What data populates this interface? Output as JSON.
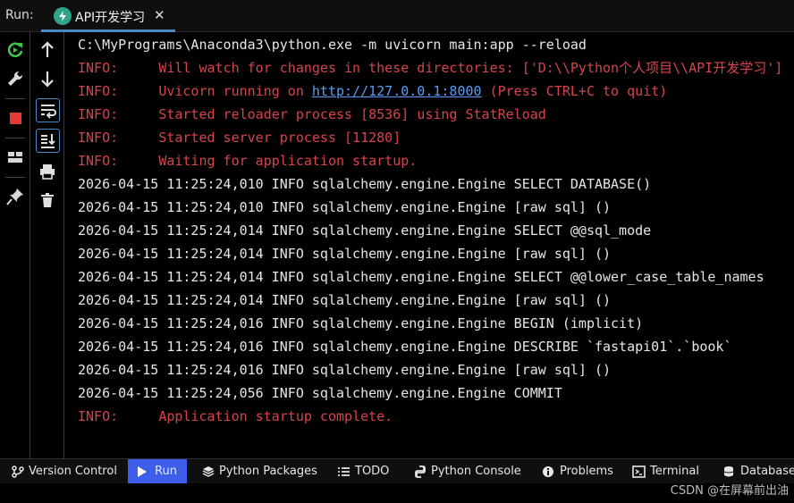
{
  "run_bar": {
    "label": "Run:",
    "tab_title": "API开发学习",
    "close_glyph": "✕"
  },
  "left_toolbar": {
    "icons": [
      "rerun-icon",
      "wrench-icon",
      "stop-icon",
      "layout-icon",
      "pin-icon"
    ]
  },
  "console_toolbar": {
    "icons": [
      "arrow-up-icon",
      "arrow-down-icon",
      "soft-wrap-icon",
      "scroll-to-end-icon",
      "print-icon",
      "trash-icon"
    ]
  },
  "console": {
    "command": "C:\\MyPrograms\\Anaconda3\\python.exe -m uvicorn main:app --reload",
    "info_prefix": "INFO:",
    "info_lines": [
      "Will watch for changes in these directories: ['D:\\\\Python个人项目\\\\API开发学习']",
      "Uvicorn running on ",
      "Started reloader process [8536] using StatReload",
      "Started server process [11280]",
      "Waiting for application startup."
    ],
    "url": "http://127.0.0.1:8000",
    "url_suffix": " (Press CTRL+C to quit)",
    "log_lines": [
      "2026-04-15 11:25:24,010 INFO sqlalchemy.engine.Engine SELECT DATABASE()",
      "2026-04-15 11:25:24,010 INFO sqlalchemy.engine.Engine [raw sql] ()",
      "2026-04-15 11:25:24,014 INFO sqlalchemy.engine.Engine SELECT @@sql_mode",
      "2026-04-15 11:25:24,014 INFO sqlalchemy.engine.Engine [raw sql] ()",
      "2026-04-15 11:25:24,014 INFO sqlalchemy.engine.Engine SELECT @@lower_case_table_names",
      "2026-04-15 11:25:24,014 INFO sqlalchemy.engine.Engine [raw sql] ()",
      "2026-04-15 11:25:24,016 INFO sqlalchemy.engine.Engine BEGIN (implicit)",
      "2026-04-15 11:25:24,016 INFO sqlalchemy.engine.Engine DESCRIBE `fastapi01`.`book`",
      "2026-04-15 11:25:24,016 INFO sqlalchemy.engine.Engine [raw sql] ()",
      "2026-04-15 11:25:24,056 INFO sqlalchemy.engine.Engine COMMIT"
    ],
    "final_line": "Application startup complete."
  },
  "bottom_bar": {
    "items": [
      {
        "label": "Version Control",
        "icon": "branch-icon"
      },
      {
        "label": "Run",
        "icon": "play-icon",
        "active": true
      },
      {
        "label": "Python Packages",
        "icon": "packages-icon"
      },
      {
        "label": "TODO",
        "icon": "list-icon"
      },
      {
        "label": "Python Console",
        "icon": "python-icon"
      },
      {
        "label": "Problems",
        "icon": "info-icon"
      },
      {
        "label": "Terminal",
        "icon": "terminal-icon"
      },
      {
        "label": "Database",
        "icon": "database-icon"
      }
    ]
  },
  "watermark": "CSDN @在屏幕前出油",
  "colors": {
    "background": "#000000",
    "info_red": "#d6434b",
    "link_blue": "#589df6",
    "active_tab": "#3d5eeb",
    "tab_underline": "#4a88c7",
    "rerun_green": "#45c24a",
    "stop_red": "#e53935"
  }
}
